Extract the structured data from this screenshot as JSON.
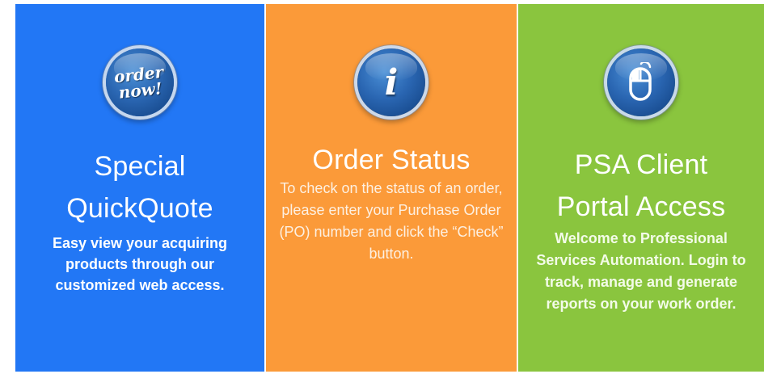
{
  "colors": {
    "panel_blue": "#2277f5",
    "panel_orange": "#fb9a39",
    "panel_green": "#8ac53e",
    "icon_blue": "#2a66b2"
  },
  "panels": [
    {
      "icon": "order-now-badge-icon",
      "icon_text": [
        "order",
        "now!"
      ],
      "title_lines": [
        "Special",
        "QuickQuote"
      ],
      "description": "Easy view your acquiring products through our customized web access."
    },
    {
      "icon": "info-icon",
      "icon_text": "i",
      "title_lines": [
        "Order Status"
      ],
      "description": "To check on the status of an order, please enter your Purchase Order (PO) number and click the “Check” button."
    },
    {
      "icon": "mouse-icon",
      "title_lines": [
        "PSA Client",
        "Portal Access"
      ],
      "description": "Welcome to Professional Services Automation. Login to track, manage and generate reports on your work order."
    }
  ]
}
